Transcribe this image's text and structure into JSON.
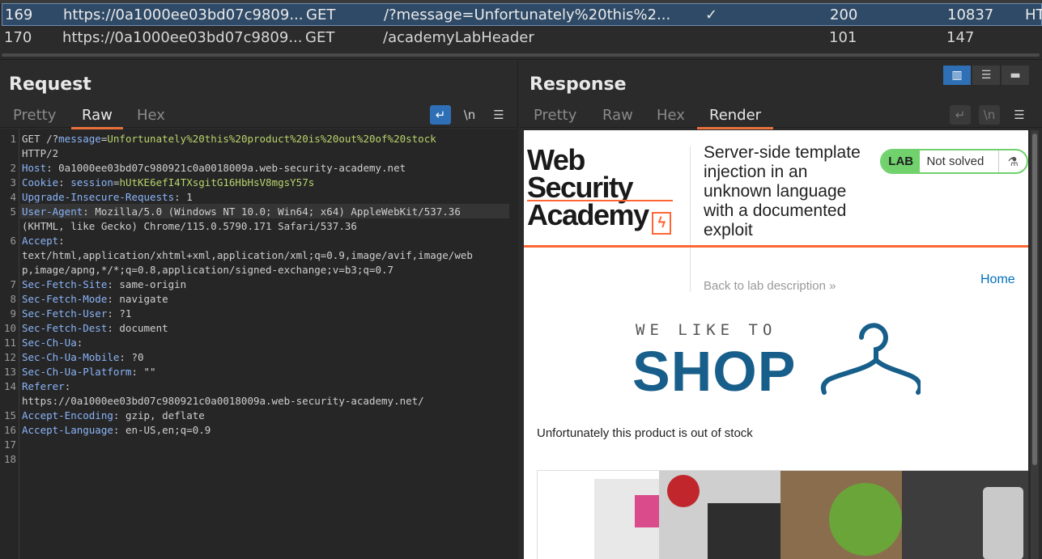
{
  "history": {
    "rows": [
      {
        "num": "169",
        "host": "https://0a1000ee03bd07c9809...",
        "method": "GET",
        "url": "/?message=Unfortunately%20this%2...",
        "edited": "✓",
        "status": "200",
        "length": "10837",
        "mime": "HT"
      },
      {
        "num": "170",
        "host": "https://0a1000ee03bd07c9809...",
        "method": "GET",
        "url": "/academyLabHeader",
        "edited": "",
        "status": "101",
        "length": "147",
        "mime": ""
      }
    ]
  },
  "request": {
    "title": "Request",
    "tabs": [
      "Pretty",
      "Raw",
      "Hex"
    ],
    "active_tab": "Raw",
    "wrap_icon": "↵",
    "newline_label": "\\n",
    "menu_icon": "☰",
    "lines": [
      {
        "n": "1",
        "parts": [
          {
            "t": "GET /?",
            "c": "v"
          },
          {
            "t": "message",
            "c": "k"
          },
          {
            "t": "=",
            "c": "v"
          },
          {
            "t": "Unfortunately%20this%20product%20is%20out%20of%20stock",
            "c": "g"
          }
        ]
      },
      {
        "n": "",
        "parts": [
          {
            "t": "HTTP/2",
            "c": "v"
          }
        ]
      },
      {
        "n": "2",
        "parts": [
          {
            "t": "Host",
            "c": "k"
          },
          {
            "t": ": 0a1000ee03bd07c980921c0a0018009a.web-security-academy.net",
            "c": "v"
          }
        ]
      },
      {
        "n": "3",
        "parts": [
          {
            "t": "Cookie",
            "c": "k"
          },
          {
            "t": ": ",
            "c": "v"
          },
          {
            "t": "session",
            "c": "k"
          },
          {
            "t": "=",
            "c": "v"
          },
          {
            "t": "hUtKE6efI4TXsgitG16HbHsV8mgsY57s",
            "c": "g"
          }
        ]
      },
      {
        "n": "4",
        "parts": [
          {
            "t": "Upgrade-Insecure-Requests",
            "c": "k"
          },
          {
            "t": ": 1",
            "c": "v"
          }
        ]
      },
      {
        "n": "5",
        "parts": [
          {
            "t": "User-Agent",
            "c": "k"
          },
          {
            "t": ": Mozilla/5.0 (Windows NT 10.0; Win64; x64) AppleWebKit/537.36",
            "c": "v"
          }
        ]
      },
      {
        "n": "",
        "parts": [
          {
            "t": "(KHTML, like Gecko) Chrome/115.0.5790.171 Safari/537.36",
            "c": "v"
          }
        ]
      },
      {
        "n": "6",
        "parts": [
          {
            "t": "Accept",
            "c": "k"
          },
          {
            "t": ":",
            "c": "v"
          }
        ]
      },
      {
        "n": "",
        "parts": [
          {
            "t": "text/html,application/xhtml+xml,application/xml;q=0.9,image/avif,image/web",
            "c": "v"
          }
        ]
      },
      {
        "n": "",
        "parts": [
          {
            "t": "p,image/apng,*/*;q=0.8,application/signed-exchange;v=b3;q=0.7",
            "c": "v"
          }
        ]
      },
      {
        "n": "7",
        "parts": [
          {
            "t": "Sec-Fetch-Site",
            "c": "k"
          },
          {
            "t": ": same-origin",
            "c": "v"
          }
        ]
      },
      {
        "n": "8",
        "parts": [
          {
            "t": "Sec-Fetch-Mode",
            "c": "k"
          },
          {
            "t": ": navigate",
            "c": "v"
          }
        ]
      },
      {
        "n": "9",
        "parts": [
          {
            "t": "Sec-Fetch-User",
            "c": "k"
          },
          {
            "t": ": ?1",
            "c": "v"
          }
        ]
      },
      {
        "n": "10",
        "parts": [
          {
            "t": "Sec-Fetch-Dest",
            "c": "k"
          },
          {
            "t": ": document",
            "c": "v"
          }
        ]
      },
      {
        "n": "11",
        "parts": [
          {
            "t": "Sec-Ch-Ua",
            "c": "k"
          },
          {
            "t": ":",
            "c": "v"
          }
        ]
      },
      {
        "n": "12",
        "parts": [
          {
            "t": "Sec-Ch-Ua-Mobile",
            "c": "k"
          },
          {
            "t": ": ?0",
            "c": "v"
          }
        ]
      },
      {
        "n": "13",
        "parts": [
          {
            "t": "Sec-Ch-Ua-Platform",
            "c": "k"
          },
          {
            "t": ": \"\"",
            "c": "v"
          }
        ]
      },
      {
        "n": "14",
        "parts": [
          {
            "t": "Referer",
            "c": "k"
          },
          {
            "t": ":",
            "c": "v"
          }
        ]
      },
      {
        "n": "",
        "parts": [
          {
            "t": "https://0a1000ee03bd07c980921c0a0018009a.web-security-academy.net/",
            "c": "v"
          }
        ]
      },
      {
        "n": "15",
        "parts": [
          {
            "t": "Accept-Encoding",
            "c": "k"
          },
          {
            "t": ": gzip, deflate",
            "c": "v"
          }
        ]
      },
      {
        "n": "16",
        "parts": [
          {
            "t": "Accept-Language",
            "c": "k"
          },
          {
            "t": ": en-US,en;q=0.9",
            "c": "v"
          }
        ]
      },
      {
        "n": "17",
        "parts": []
      },
      {
        "n": "18",
        "parts": []
      }
    ]
  },
  "response": {
    "title": "Response",
    "tabs": [
      "Pretty",
      "Raw",
      "Hex",
      "Render"
    ],
    "active_tab": "Render",
    "wrap_icon": "↵",
    "newline_label": "\\n",
    "menu_icon": "☰",
    "render": {
      "logo_line1": "Web Security",
      "logo_line2": "Academy",
      "lab_title": "Server-side template injection in an unknown language with a documented exploit",
      "lab_badge": "LAB",
      "lab_status": "Not solved",
      "back_link": "Back to lab description »",
      "home_link": "Home",
      "shop_small": "WE LIKE TO",
      "shop_big": "SHOP",
      "message": "Unfortunately this product is out of stock"
    }
  },
  "colors": {
    "accent": "#e8703a",
    "selection": "#2f4a66",
    "blue_button": "#2f6fb5",
    "lab_green": "#70d16d",
    "brand_orange": "#ff6633",
    "shop_blue": "#175e8a"
  }
}
